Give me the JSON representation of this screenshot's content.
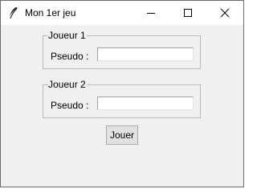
{
  "window": {
    "title": "Mon 1er jeu",
    "icons": {
      "app": "feather-icon",
      "minimize": "minimize-icon",
      "maximize": "maximize-icon",
      "close": "close-icon"
    }
  },
  "players": [
    {
      "group_label": "Joueur 1",
      "field_label": "Pseudo :",
      "value": ""
    },
    {
      "group_label": "Joueur 2",
      "field_label": "Pseudo :",
      "value": ""
    }
  ],
  "actions": {
    "play_label": "Jouer"
  }
}
